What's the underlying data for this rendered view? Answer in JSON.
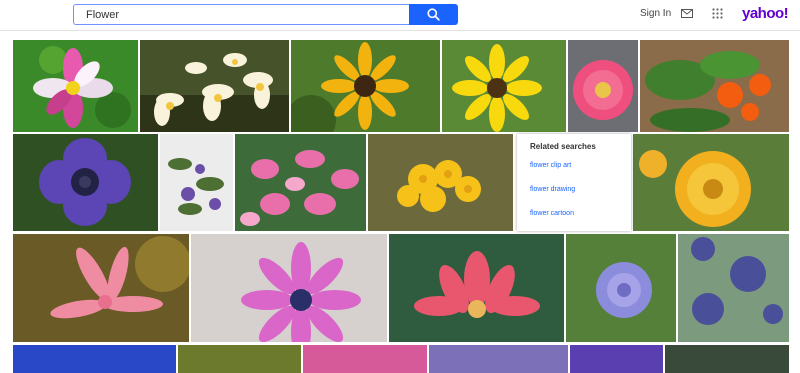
{
  "search": {
    "value": "Flower"
  },
  "header": {
    "signin_label": "Sign In",
    "logo_text": "yahoo!",
    "brand_color": "#6001d2",
    "accent_color": "#1a64fd"
  },
  "icons": {
    "search": "search-icon",
    "mail": "mail-icon",
    "apps": "apps-grid-icon"
  },
  "related_searches": {
    "title": "Related searches",
    "items": [
      "flower clip art",
      "flower drawing",
      "flower cartoon"
    ]
  },
  "image_results": [
    {
      "subject": "pink and white cosmos"
    },
    {
      "subject": "white plumeria"
    },
    {
      "subject": "yellow black-eyed susan"
    },
    {
      "subject": "yellow gerbera daisy"
    },
    {
      "subject": "pink gerbera"
    },
    {
      "subject": "orange flowers on leaves"
    },
    {
      "subject": "purple anemone"
    },
    {
      "subject": "small purple flowers on vine"
    },
    {
      "subject": "pink cyclamen"
    },
    {
      "subject": "yellow flower cluster"
    },
    {
      "subject": "yellow marigold"
    },
    {
      "subject": "pink macro petals"
    },
    {
      "subject": "pink daisy"
    },
    {
      "subject": "pink lotus"
    },
    {
      "subject": "blue scabiosa"
    },
    {
      "subject": "blue globe thistle"
    },
    {
      "subject": "blue flowers"
    },
    {
      "subject": "yellow daisies"
    },
    {
      "subject": "pink flowers"
    },
    {
      "subject": "purple flowers"
    },
    {
      "subject": "purple iris"
    },
    {
      "subject": "flowers"
    }
  ]
}
